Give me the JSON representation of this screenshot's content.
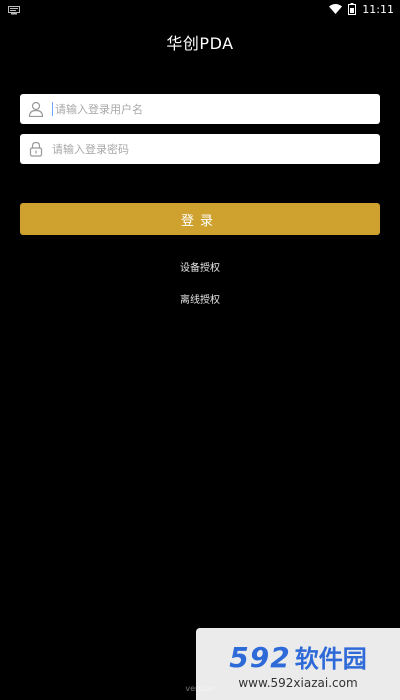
{
  "statusbar": {
    "time": "11:11"
  },
  "app": {
    "title": "华创PDA"
  },
  "login": {
    "username_placeholder": "请输入登录用户名",
    "password_placeholder": "请输入登录密码",
    "button_label": "登录"
  },
  "links": {
    "device_auth": "设备授权",
    "offline_auth": "离线授权"
  },
  "footer": {
    "version": "version"
  },
  "watermark": {
    "logo_number": "592",
    "logo_text": "软件园",
    "url": "www.592xiazai.com"
  },
  "colors": {
    "background": "#000000",
    "accent": "#cfa22f",
    "input_bg": "#ffffff"
  }
}
